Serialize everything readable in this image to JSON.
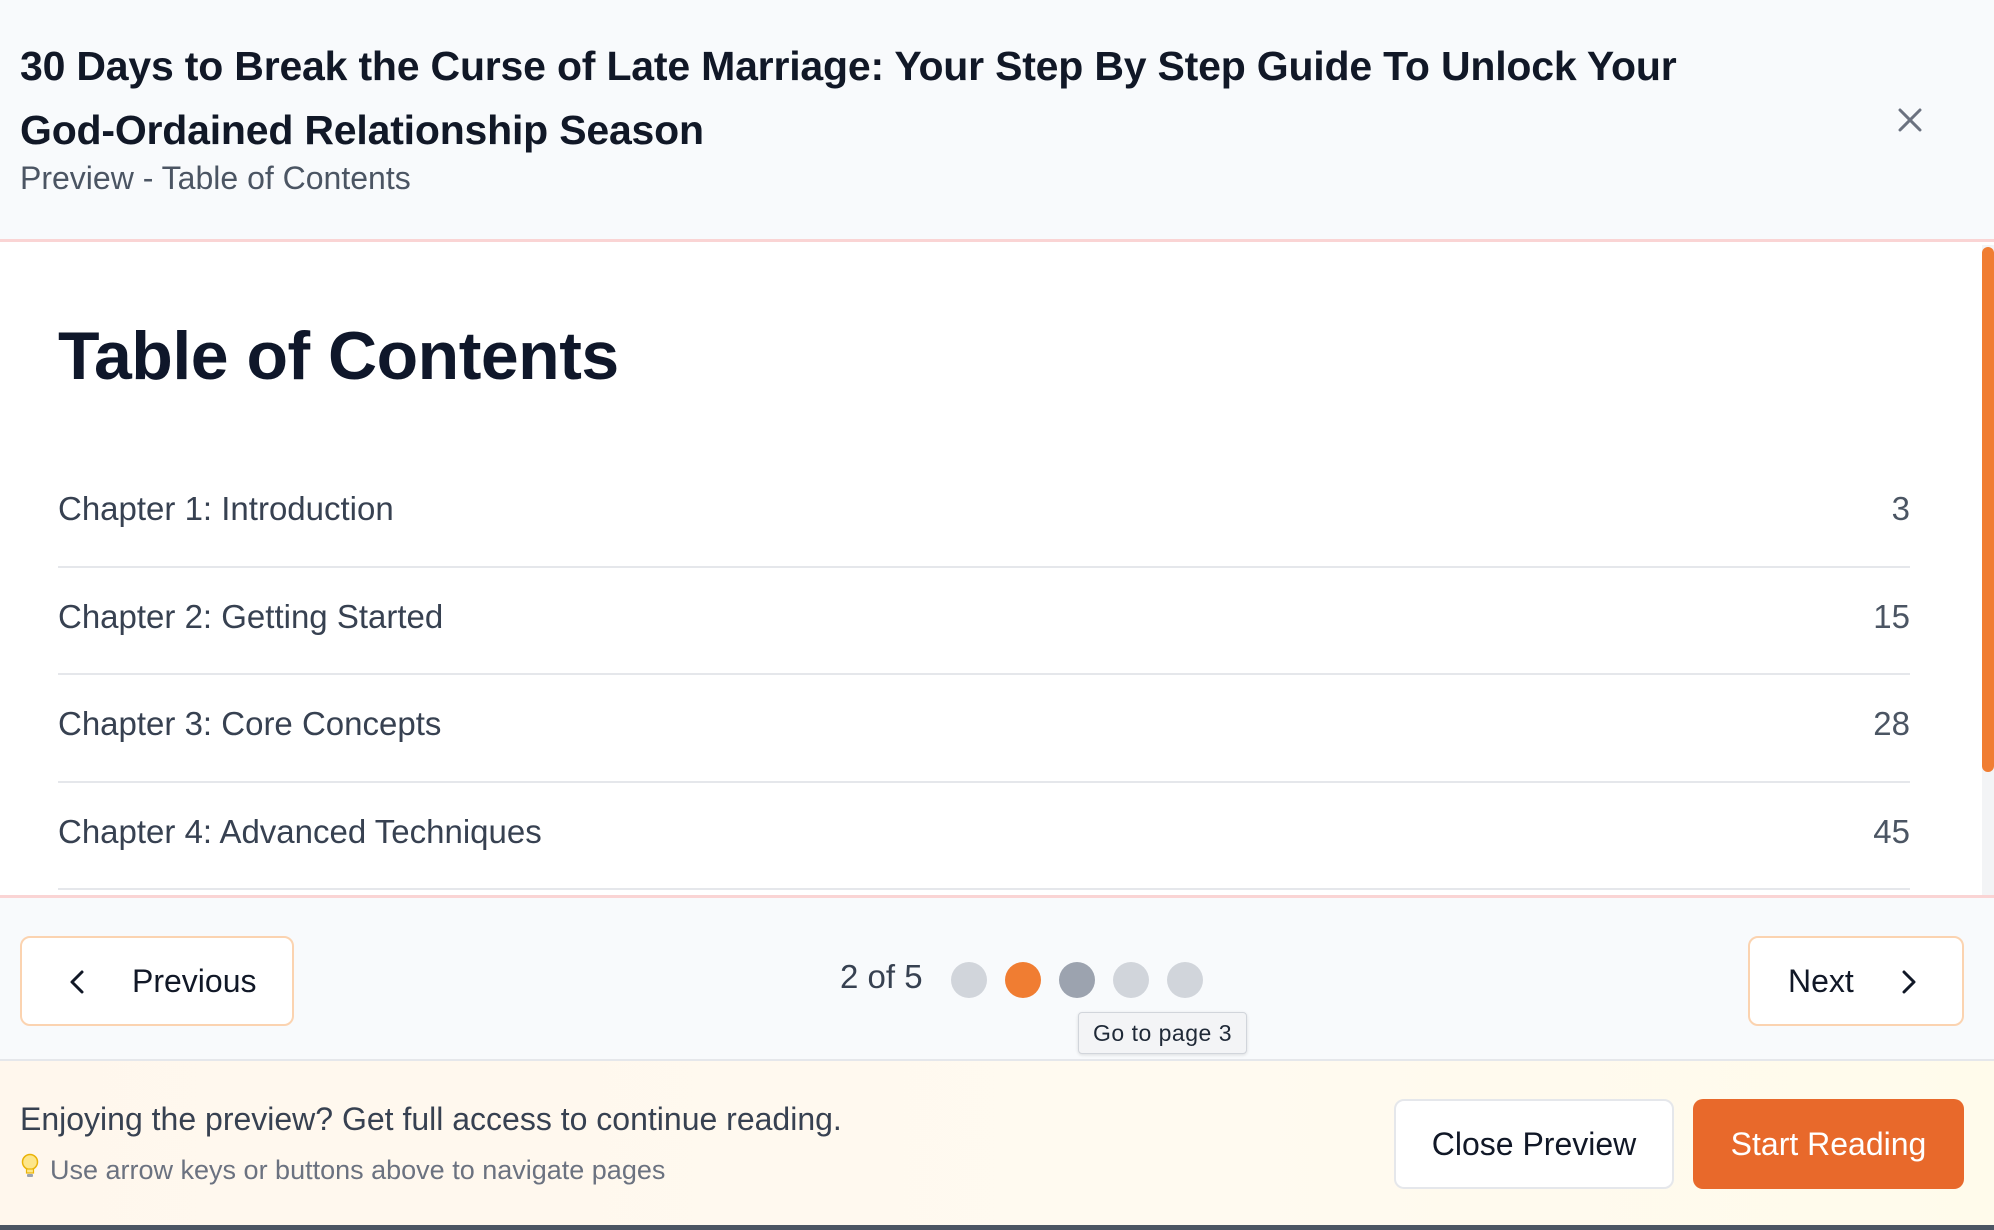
{
  "header": {
    "book_title": "30 Days to Break the Curse of Late Marriage: Your Step By Step Guide To Unlock Your God-Ordained Relationship Season",
    "subtitle": "Preview - Table of Contents",
    "close_icon": "close-icon"
  },
  "content": {
    "heading": "Table of Contents",
    "chapters": [
      {
        "title": "Chapter 1: Introduction",
        "page": "3"
      },
      {
        "title": "Chapter 2: Getting Started",
        "page": "15"
      },
      {
        "title": "Chapter 3: Core Concepts",
        "page": "28"
      },
      {
        "title": "Chapter 4: Advanced Techniques",
        "page": "45"
      }
    ]
  },
  "pager": {
    "previous_label": "Previous",
    "next_label": "Next",
    "page_count": "2 of 5",
    "current_page": 2,
    "total_pages": 5,
    "tooltip": "Go to page 3"
  },
  "footer": {
    "message": "Enjoying the preview? Get full access to continue reading.",
    "hint": "Use arrow keys or buttons above to navigate pages",
    "close_preview_label": "Close Preview",
    "start_reading_label": "Start Reading"
  },
  "colors": {
    "accent": "#e8692b",
    "active_dot": "#f07d32",
    "inactive_dot": "#d1d5db",
    "hover_dot": "#9ca3af"
  }
}
